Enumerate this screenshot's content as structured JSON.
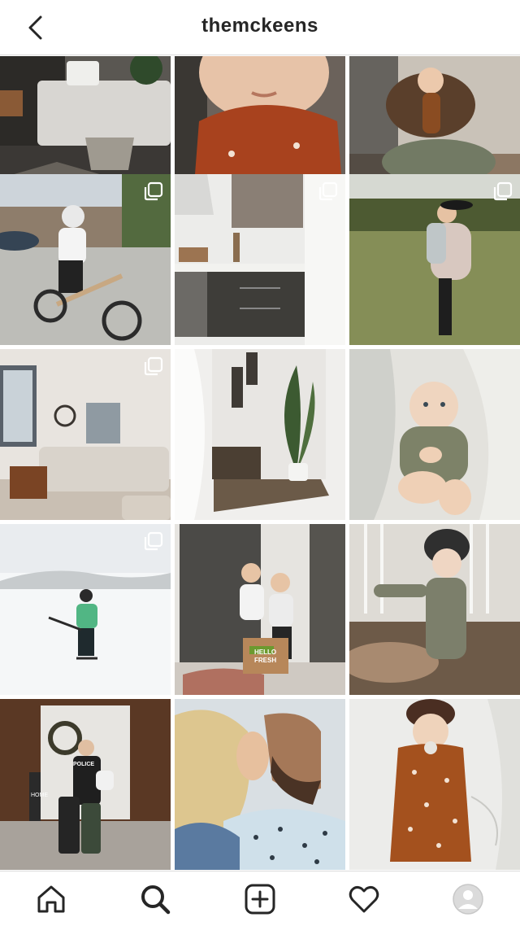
{
  "header": {
    "title": "themckeens",
    "back_icon": "chevron-left-icon"
  },
  "grid": {
    "posts": [
      {
        "id": 1,
        "subject": "bedroom",
        "multi": false
      },
      {
        "id": 2,
        "subject": "toddler closeup",
        "multi": false
      },
      {
        "id": 3,
        "subject": "mom and baby",
        "multi": false
      },
      {
        "id": 4,
        "subject": "boy on balance bike",
        "multi": true
      },
      {
        "id": 5,
        "subject": "kitchen",
        "multi": true
      },
      {
        "id": 6,
        "subject": "mom and toddler in field",
        "multi": true
      },
      {
        "id": 7,
        "subject": "living room",
        "multi": true
      },
      {
        "id": 8,
        "subject": "entryway with plant",
        "multi": false
      },
      {
        "id": 9,
        "subject": "baby on blanket",
        "multi": false
      },
      {
        "id": 10,
        "subject": "kid skating",
        "multi": true
      },
      {
        "id": 11,
        "subject": "two kids with box",
        "multi": false
      },
      {
        "id": 12,
        "subject": "baby in crib room",
        "multi": false
      },
      {
        "id": 13,
        "subject": "family on porch",
        "multi": false
      },
      {
        "id": 14,
        "subject": "couple kissing",
        "multi": false
      },
      {
        "id": 15,
        "subject": "baby in onesie",
        "multi": false
      }
    ],
    "box_label_line1": "HELLO",
    "box_label_line2": "FRESH",
    "police_label": "POLICE",
    "home_sign": "HOME"
  },
  "tabbar": {
    "items": [
      {
        "name": "home",
        "icon": "home-icon",
        "active": false
      },
      {
        "name": "search",
        "icon": "search-icon",
        "active": true
      },
      {
        "name": "new-post",
        "icon": "plus-square-icon",
        "active": false
      },
      {
        "name": "activity",
        "icon": "heart-icon",
        "active": false
      },
      {
        "name": "profile",
        "icon": "avatar-icon",
        "active": false
      }
    ]
  },
  "colors": {
    "border": "#dbdbdb",
    "text": "#262626",
    "background": "#ffffff"
  }
}
